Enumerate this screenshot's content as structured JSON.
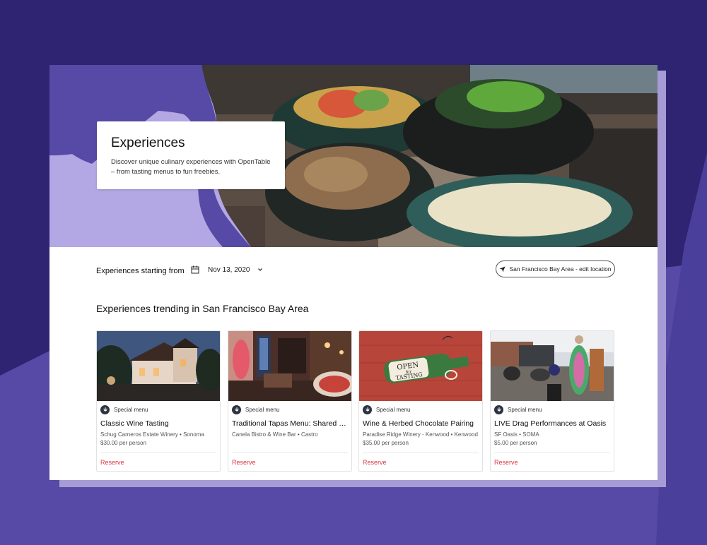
{
  "hero": {
    "title": "Experiences",
    "description": "Discover unique culinary experiences with OpenTable – from tasting menus to fun freebies."
  },
  "filter": {
    "label": "Experiences starting from",
    "date": "Nov 13, 2020",
    "location": "San Francisco Bay Area - edit location"
  },
  "section": {
    "title": "Experiences trending in San Francisco Bay Area"
  },
  "cards": [
    {
      "tag": "Special menu",
      "title": "Classic Wine Tasting",
      "meta": "Schug Carneros Estate Winery • Sonoma",
      "price": "$30.00 per person",
      "cta": "Reserve"
    },
    {
      "tag": "Special menu",
      "title": "Traditional Tapas Menu: Shared Pl...",
      "meta": "Canela Bistro & Wine Bar • Castro",
      "price": "",
      "cta": "Reserve"
    },
    {
      "tag": "Special menu",
      "title": "Wine & Herbed Chocolate Pairing",
      "meta": "Paradise Ridge Winery - Kenwood • Kenwood",
      "price": "$35.00 per person",
      "cta": "Reserve",
      "sign_text_1": "OPEN",
      "sign_text_2": "for",
      "sign_text_3": "TASTING"
    },
    {
      "tag": "Special menu",
      "title": "LIVE Drag Performances at Oasis",
      "meta": "SF Oasis • SOMA",
      "price": "$5.00 per person",
      "cta": "Reserve"
    }
  ],
  "colors": {
    "page_bg": "#2e2472",
    "accent_purple": "#574aa6",
    "light_purple": "#b3a8e3",
    "reserve_red": "#da3743"
  },
  "icons": {
    "calendar": "calendar-icon",
    "chevron": "chevron-down-icon",
    "location": "location-arrow-icon",
    "tag": "special-menu-icon"
  }
}
